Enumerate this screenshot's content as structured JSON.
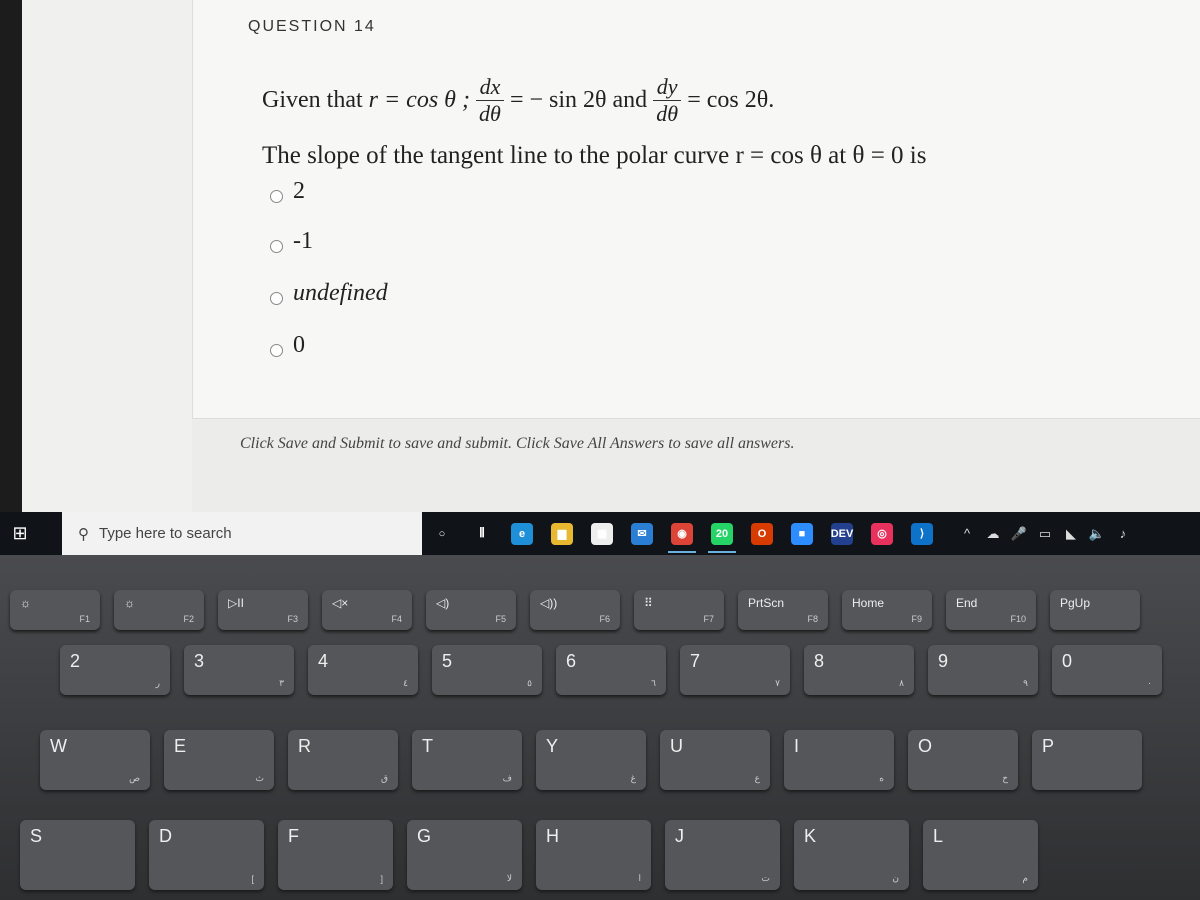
{
  "question": {
    "title": "QUESTION 14",
    "given_prefix": "Given that",
    "r_eq": "r = cos θ ;",
    "dx": "dx",
    "dtheta": "dθ",
    "dx_eq": "= − sin 2θ and",
    "dy": "dy",
    "dy_eq": "= cos 2θ.",
    "prompt": "The slope of the tangent line to the polar curve r = cos θ at θ = 0 is",
    "options": [
      "2",
      "-1",
      "undefined",
      "0"
    ]
  },
  "footer_note": "Click Save and Submit to save and submit. Click Save All Answers to save all answers.",
  "taskbar": {
    "search_placeholder": "Type here to search",
    "apps": [
      {
        "name": "cortana-icon",
        "glyph": "○",
        "color": "#101418"
      },
      {
        "name": "task-view-icon",
        "glyph": "⫼",
        "color": "#101418"
      },
      {
        "name": "edge-icon",
        "glyph": "e",
        "color": "#1f8fd8"
      },
      {
        "name": "file-explorer-icon",
        "glyph": "▆",
        "color": "#e8b830"
      },
      {
        "name": "store-icon",
        "glyph": "▦",
        "color": "#eeeeee"
      },
      {
        "name": "mail-icon",
        "glyph": "✉",
        "color": "#2a7fd4"
      },
      {
        "name": "chrome-icon",
        "glyph": "◉",
        "color": "#db4437"
      },
      {
        "name": "whatsapp-icon",
        "glyph": "20",
        "color": "#25d366"
      },
      {
        "name": "office-icon",
        "glyph": "O",
        "color": "#d83b01"
      },
      {
        "name": "zoom-icon",
        "glyph": "■",
        "color": "#2d8cff"
      },
      {
        "name": "dev-icon",
        "glyph": "DEV",
        "color": "#23408e"
      },
      {
        "name": "creative-cloud-icon",
        "glyph": "◎",
        "color": "#e8315d"
      },
      {
        "name": "vscode-icon",
        "glyph": "⟩",
        "color": "#0e72c8"
      }
    ],
    "tray": [
      "^",
      "☁",
      "🎤",
      "▭",
      "◣",
      "🔈",
      "♪"
    ]
  },
  "keyboard": {
    "fn_row": [
      [
        "☼",
        "F1"
      ],
      [
        "☼",
        "F2"
      ],
      [
        "▷II",
        "F3"
      ],
      [
        "◁×",
        "F4"
      ],
      [
        "◁)",
        "F5"
      ],
      [
        "◁))",
        "F6"
      ],
      [
        "⠿",
        "F7"
      ],
      [
        "PrtScn",
        "F8"
      ],
      [
        "Home",
        "F9"
      ],
      [
        "End",
        "F10"
      ],
      [
        "PgUp",
        ""
      ]
    ],
    "num_row": [
      [
        "2",
        "ر"
      ],
      [
        "3",
        "٣"
      ],
      [
        "4",
        "٤"
      ],
      [
        "5",
        "٥"
      ],
      [
        "6",
        "٦"
      ],
      [
        "7",
        "٧"
      ],
      [
        "8",
        "٨"
      ],
      [
        "9",
        "٩"
      ],
      [
        "0",
        "٠"
      ]
    ],
    "top_row": [
      [
        "W",
        "ص"
      ],
      [
        "E",
        "ث"
      ],
      [
        "R",
        "ق"
      ],
      [
        "T",
        "ف"
      ],
      [
        "Y",
        "غ"
      ],
      [
        "U",
        "ع"
      ],
      [
        "I",
        "ه"
      ],
      [
        "O",
        "خ"
      ],
      [
        "P",
        ""
      ]
    ],
    "home_row": [
      [
        "S",
        ""
      ],
      [
        "D",
        "["
      ],
      [
        "F",
        "]"
      ],
      [
        "G",
        "ﻻ"
      ],
      [
        "H",
        "ا"
      ],
      [
        "J",
        "ت"
      ],
      [
        "K",
        "ن"
      ],
      [
        "L",
        "م"
      ]
    ]
  }
}
